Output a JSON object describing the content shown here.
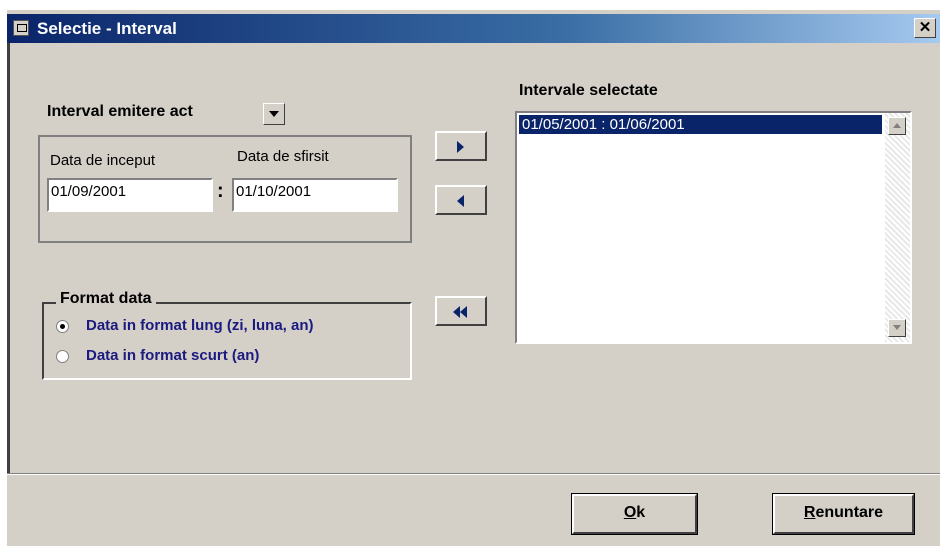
{
  "window": {
    "title": "Selectie - Interval",
    "close_glyph": "✕"
  },
  "interval_combo": {
    "label": "Interval emitere act"
  },
  "dates": {
    "start_label": "Data de inceput",
    "start_value": "01/09/2001",
    "separator": ":",
    "end_label": "Data de sfirsit",
    "end_value": "01/10/2001"
  },
  "format": {
    "legend": "Format data",
    "options": [
      {
        "label": "Data in format lung (zi, luna, an)",
        "checked": true
      },
      {
        "label": "Data in format scurt (an)",
        "checked": false
      }
    ]
  },
  "selected": {
    "label": "Intervale selectate",
    "items": [
      "01/05/2001 : 01/06/2001"
    ]
  },
  "buttons": {
    "ok_mnemonic": "O",
    "ok_rest": "k",
    "cancel_mnemonic": "R",
    "cancel_rest": "enuntare"
  }
}
